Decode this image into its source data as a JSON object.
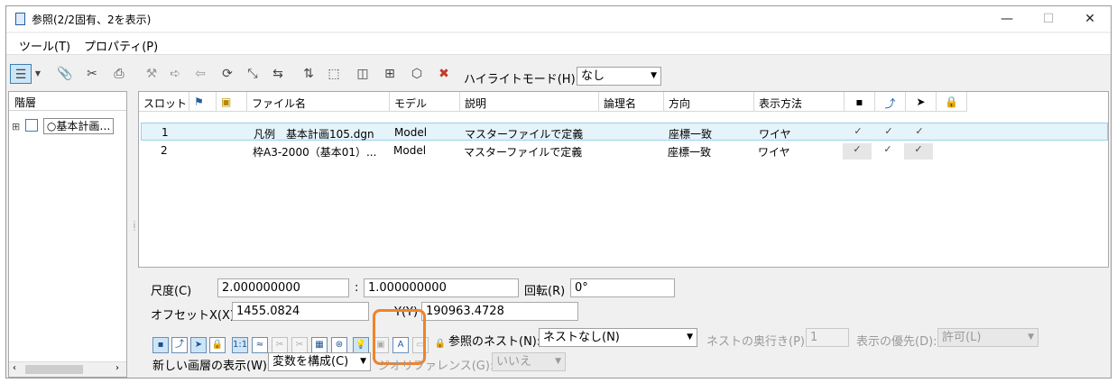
{
  "window": {
    "title": "参照(2/2固有、2を表示)",
    "minimize": "—",
    "maximize": "☐",
    "close": "✕"
  },
  "menu": [
    {
      "label": "ツール(T)"
    },
    {
      "label": "プロパティ(P)"
    }
  ],
  "toolbar": {
    "highlight_label": "ハイライトモード(H):",
    "highlight_value": "なし"
  },
  "tree": {
    "header": "階層",
    "expander": "⊞",
    "node_label": "○基本計画…"
  },
  "grid": {
    "columns": [
      "スロット",
      "",
      "",
      "ファイル名",
      "モデル",
      "説明",
      "論理名",
      "方向",
      "表示方法",
      "",
      "",
      "",
      ""
    ],
    "rows": [
      {
        "slot": "1",
        "file": "凡例　基本計画105.dgn",
        "model": "Model",
        "desc": "マスターファイルで定義",
        "logical": "",
        "orient": "座標一致",
        "display": "ワイヤ",
        "c1": "✓",
        "c2": "✓",
        "c3": "✓"
      },
      {
        "slot": "2",
        "file": "枠A3-2000（基本01）...",
        "model": "Model",
        "desc": "マスターファイルで定義",
        "logical": "",
        "orient": "座標一致",
        "display": "ワイヤ",
        "c1": "✓",
        "c2": "✓",
        "c3": "✓"
      }
    ]
  },
  "props": {
    "scale_label": "尺度(C)",
    "scale1": "2.000000000",
    "colon": ":",
    "scale2": "1.000000000",
    "rotate_label": "回転(R)",
    "rotate": "0°",
    "offset_x_label": "オフセットX(X)",
    "offset_x": "1455.0824",
    "offset_y_label": "Y(Y)",
    "offset_y": "190963.4728",
    "nest_label": "参照のネスト(N):",
    "nest_value": "ネストなし(N)",
    "depth_label": "ネストの奥行き(P):",
    "depth_value": "1",
    "priority_label": "表示の優先(D):",
    "priority_value": "許可(L)",
    "newlevel_label": "新しい画層の表示(W):",
    "newlevel_value": "変数を構成(C)",
    "georef_label": "ジオリファレンス(G):",
    "georef_value": "いいえ"
  },
  "colors": {
    "highlight_ring": "#f0832a",
    "selected_row": "#e5f3fb",
    "accent": "#1f5fa8"
  }
}
